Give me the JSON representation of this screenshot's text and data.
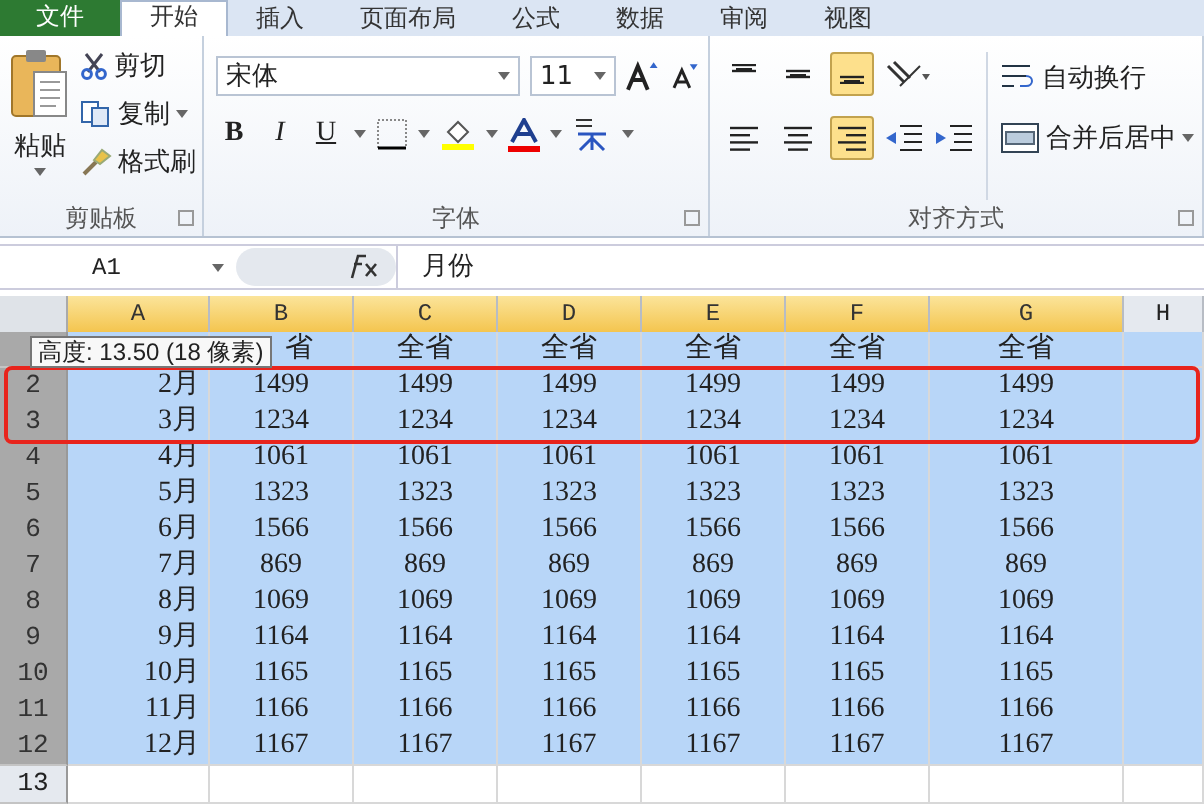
{
  "tabs": [
    {
      "label": "文件",
      "kind": "file"
    },
    {
      "label": "开始",
      "kind": "tab",
      "selected": true
    },
    {
      "label": "插入",
      "kind": "tab",
      "selected": false
    },
    {
      "label": "页面布局",
      "kind": "tab",
      "selected": false
    },
    {
      "label": "公式",
      "kind": "tab",
      "selected": false
    },
    {
      "label": "数据",
      "kind": "tab",
      "selected": false
    },
    {
      "label": "审阅",
      "kind": "tab",
      "selected": false
    },
    {
      "label": "视图",
      "kind": "tab",
      "selected": false
    }
  ],
  "clipboard": {
    "paste": "粘贴",
    "cut": "剪切",
    "copy": "复制",
    "format_painter": "格式刷",
    "label": "剪贴板"
  },
  "font": {
    "name": "宋体",
    "size": "11",
    "label": "字体",
    "style_buttons": [
      {
        "label": "B",
        "kind": "bold"
      },
      {
        "label": "I",
        "kind": "italic"
      },
      {
        "label": "U",
        "kind": "underline"
      }
    ]
  },
  "alignment": {
    "vertical": [
      {
        "kind": "top",
        "selected": false
      },
      {
        "kind": "middle",
        "selected": false
      },
      {
        "kind": "bottom",
        "selected": true
      }
    ],
    "horizontal": [
      {
        "kind": "left",
        "selected": false
      },
      {
        "kind": "center",
        "selected": false
      },
      {
        "kind": "right",
        "selected": true
      }
    ],
    "wrap": "自动换行",
    "merge": "合并后居中",
    "label": "对齐方式"
  },
  "formula_bar": {
    "name_box": "A1",
    "formula": "月份"
  },
  "sheet": {
    "tooltip": "高度: 13.50 (18 像素)",
    "columns": [
      {
        "label": "A",
        "selected": true
      },
      {
        "label": "B",
        "selected": true
      },
      {
        "label": "C",
        "selected": true
      },
      {
        "label": "D",
        "selected": true
      },
      {
        "label": "E",
        "selected": true
      },
      {
        "label": "F",
        "selected": true
      },
      {
        "label": "G",
        "selected": true
      },
      {
        "label": "H",
        "selected": false
      }
    ],
    "rows": [
      {
        "selected": true,
        "highlighted": false,
        "cells": [
          null,
          "省",
          "全省",
          "全省",
          "全省",
          "全省",
          "全省"
        ]
      },
      {
        "header": "2",
        "selected": true,
        "highlighted": true,
        "cells": [
          "2月",
          "1499",
          "1499",
          "1499",
          "1499",
          "1499",
          "1499"
        ]
      },
      {
        "header": "3",
        "selected": true,
        "highlighted": true,
        "cells": [
          "3月",
          "1234",
          "1234",
          "1234",
          "1234",
          "1234",
          "1234"
        ]
      },
      {
        "header": "4",
        "selected": true,
        "highlighted": false,
        "cells": [
          "4月",
          "1061",
          "1061",
          "1061",
          "1061",
          "1061",
          "1061"
        ]
      },
      {
        "header": "5",
        "selected": true,
        "highlighted": false,
        "cells": [
          "5月",
          "1323",
          "1323",
          "1323",
          "1323",
          "1323",
          "1323"
        ]
      },
      {
        "header": "6",
        "selected": true,
        "highlighted": false,
        "cells": [
          "6月",
          "1566",
          "1566",
          "1566",
          "1566",
          "1566",
          "1566"
        ]
      },
      {
        "header": "7",
        "selected": true,
        "highlighted": false,
        "cells": [
          "7月",
          "869",
          "869",
          "869",
          "869",
          "869",
          "869"
        ]
      },
      {
        "header": "8",
        "selected": true,
        "highlighted": false,
        "cells": [
          "8月",
          "1069",
          "1069",
          "1069",
          "1069",
          "1069",
          "1069"
        ]
      },
      {
        "header": "9",
        "selected": true,
        "highlighted": false,
        "cells": [
          "9月",
          "1164",
          "1164",
          "1164",
          "1164",
          "1164",
          "1164"
        ]
      },
      {
        "header": "10",
        "selected": true,
        "highlighted": false,
        "cells": [
          "10月",
          "1165",
          "1165",
          "1165",
          "1165",
          "1165",
          "1165"
        ]
      },
      {
        "header": "11",
        "selected": true,
        "highlighted": false,
        "cells": [
          "11月",
          "1166",
          "1166",
          "1166",
          "1166",
          "1166",
          "1166"
        ]
      },
      {
        "header": "12",
        "selected": true,
        "highlighted": false,
        "cells": [
          "12月",
          "1167",
          "1167",
          "1167",
          "1167",
          "1167",
          "1167"
        ]
      },
      {
        "header": "13",
        "selected": false,
        "highlighted": false
      }
    ]
  }
}
